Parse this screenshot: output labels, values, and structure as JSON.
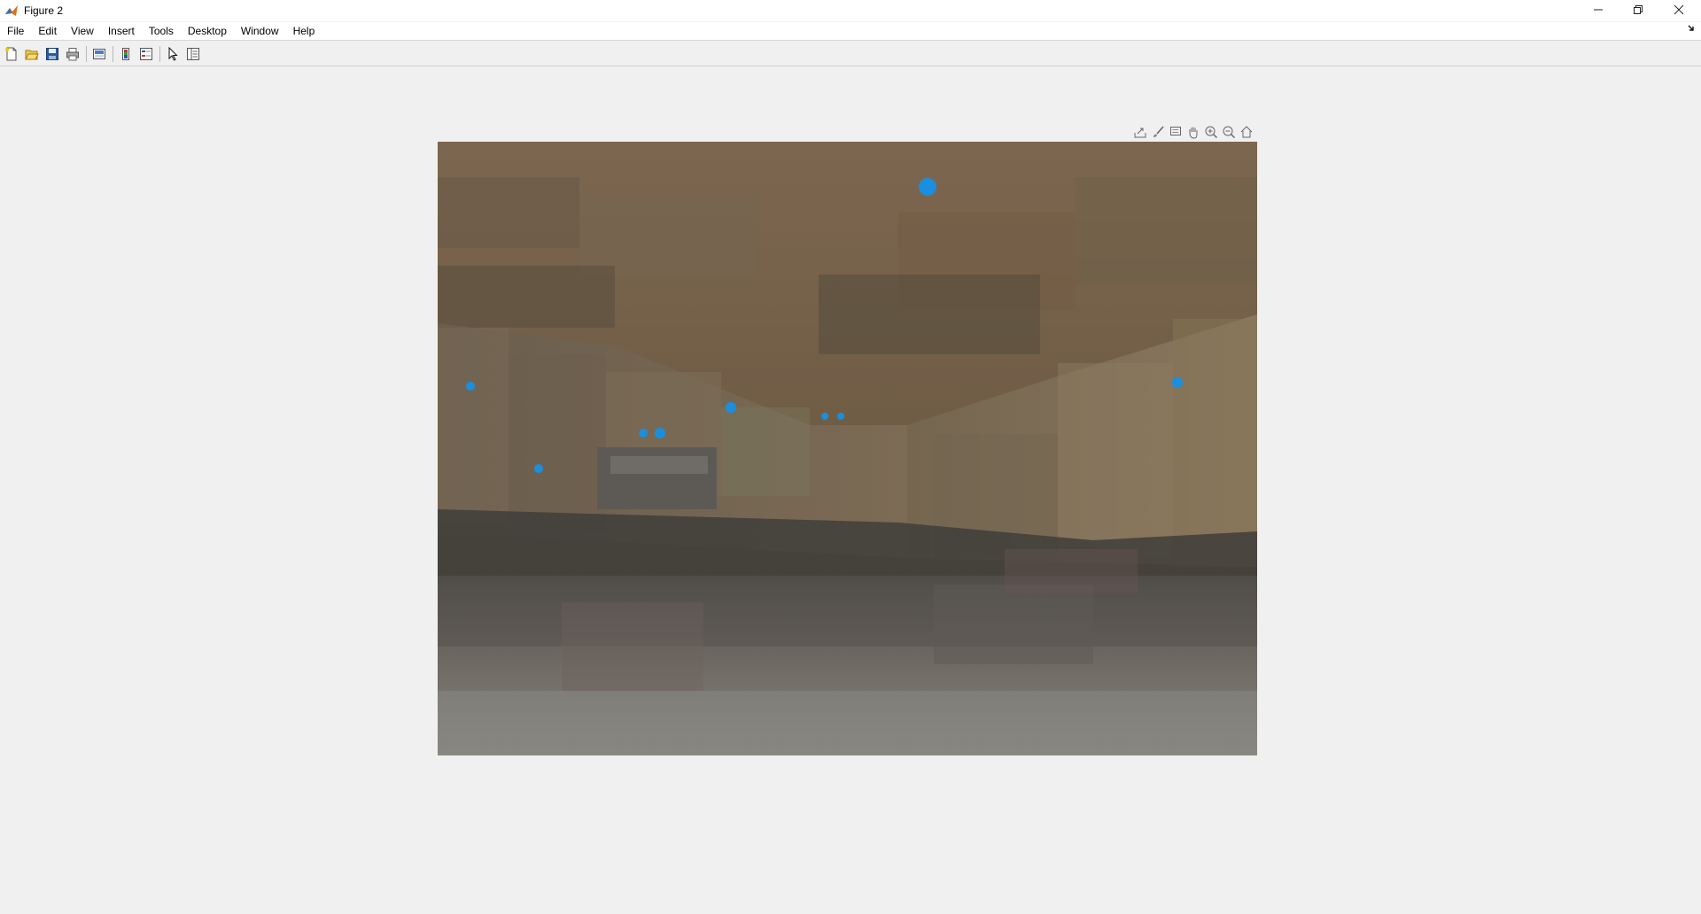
{
  "window": {
    "title": "Figure 2",
    "minimize_icon": "minimize-icon",
    "restore_icon": "restore-icon",
    "close_icon": "close-icon"
  },
  "menu": {
    "items": [
      "File",
      "Edit",
      "View",
      "Insert",
      "Tools",
      "Desktop",
      "Window",
      "Help"
    ]
  },
  "toolbar": {
    "buttons": [
      "new-figure-icon",
      "open-file-icon",
      "save-icon",
      "print-icon",
      "link-plot-icon",
      "insert-colorbar-icon",
      "insert-legend-icon",
      "edit-plot-icon",
      "open-property-inspector-icon"
    ]
  },
  "axes_toolbar": {
    "buttons": [
      "export-icon",
      "brush-icon",
      "data-tips-icon",
      "pan-icon",
      "zoom-in-icon",
      "zoom-out-icon",
      "restore-view-icon"
    ]
  },
  "colors": {
    "marker": "#1a8fe0",
    "window_bg": "#f0f0f0"
  },
  "image": {
    "description_marker_count": 9
  }
}
